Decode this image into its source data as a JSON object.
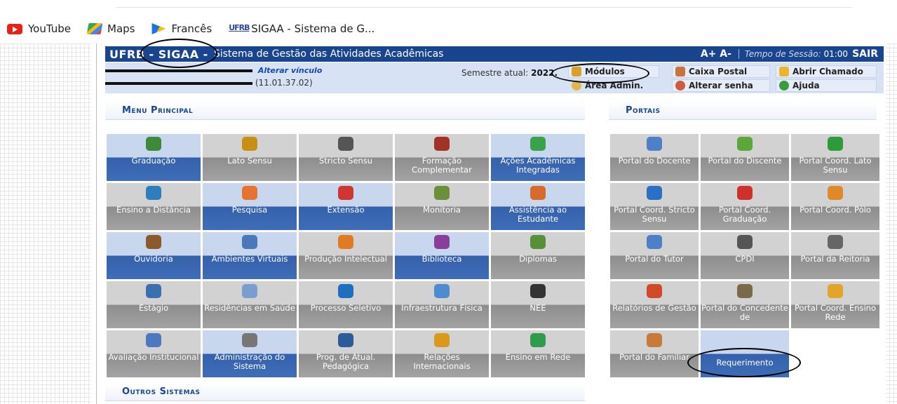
{
  "bookmarks": [
    {
      "label": "YouTube",
      "icon": "youtube-icon"
    },
    {
      "label": "Maps",
      "icon": "maps-icon"
    },
    {
      "label": "Francês",
      "icon": "translate-icon"
    },
    {
      "label": "SIGAA - Sistema de G...",
      "icon": "ufrb-icon"
    }
  ],
  "header": {
    "brand": "UFRB - SIGAA -",
    "system_name": "Sistema de Gestão das Atividades Acadêmicas",
    "font_size": "A+ A-",
    "session_label": "Tempo de Sessão:",
    "session_time": "01:00",
    "logout": "SAIR"
  },
  "user": {
    "change_link": "Alterar vínculo",
    "dept_code": "(11.01.37.02)",
    "semester_label": "Semestre atual:",
    "semester_value": "2022."
  },
  "quick_links": {
    "modulos": "Módulos",
    "caixa_postal": "Caixa Postal",
    "abrir_chamado": "Abrir Chamado",
    "area_admin": "Área Admin.",
    "alterar_senha": "Alterar senha",
    "ajuda": "Ajuda"
  },
  "menu_principal": {
    "title": "Menu Principal",
    "tiles": [
      {
        "label": "Graduação",
        "style": "blue",
        "icon": "books-icon",
        "color": "#3f8a3a"
      },
      {
        "label": "Lato Sensu",
        "style": "gray",
        "icon": "folder-icon",
        "color": "#c79014"
      },
      {
        "label": "Stricto Sensu",
        "style": "gray",
        "icon": "briefcase-icon",
        "color": "#555555"
      },
      {
        "label": "Formação Complementar",
        "style": "gray",
        "icon": "book-icon",
        "color": "#a03226"
      },
      {
        "label": "Ações Acadêmicas Integradas",
        "style": "blue",
        "icon": "puzzle-icon",
        "color": "#3aa34a"
      },
      {
        "label": "Ensino a Distância",
        "style": "gray",
        "icon": "globe-icon",
        "color": "#2c7fbf"
      },
      {
        "label": "Pesquisa",
        "style": "blue",
        "icon": "flask-icon",
        "color": "#e8732f"
      },
      {
        "label": "Extensão",
        "style": "blue",
        "icon": "gift-icon",
        "color": "#d0352f"
      },
      {
        "label": "Monitoria",
        "style": "gray",
        "icon": "presentation-icon",
        "color": "#6b8f3a"
      },
      {
        "label": "Assistência ao Estudante",
        "style": "blue",
        "icon": "user-support-icon",
        "color": "#d86a2a"
      },
      {
        "label": "Ouvidoria",
        "style": "blue",
        "icon": "user-icon",
        "color": "#8a5a2b"
      },
      {
        "label": "Ambientes Virtuais",
        "style": "blue",
        "icon": "group-icon",
        "color": "#4a78b8"
      },
      {
        "label": "Produção Intelectual",
        "style": "gray",
        "icon": "user-edit-icon",
        "color": "#e07a23"
      },
      {
        "label": "Biblioteca",
        "style": "blue",
        "icon": "book-open-icon",
        "color": "#8a3d9a"
      },
      {
        "label": "Diplomas",
        "style": "gray",
        "icon": "certificate-icon",
        "color": "#5a8f3a"
      },
      {
        "label": "Estágio",
        "style": "gray",
        "icon": "id-card-icon",
        "color": "#3b6fb0"
      },
      {
        "label": "Residências em Saúde",
        "style": "gray",
        "icon": "doctor-icon",
        "color": "#7a9ed0"
      },
      {
        "label": "Processo Seletivo",
        "style": "gray",
        "icon": "spiral-icon",
        "color": "#1f6fc0"
      },
      {
        "label": "Infraestrutura Física",
        "style": "gray",
        "icon": "network-icon",
        "color": "#4f8bd0"
      },
      {
        "label": "NEE",
        "style": "gray",
        "icon": "accessibility-icon",
        "color": "#333333"
      },
      {
        "label": "Avaliação Institucional",
        "style": "gray",
        "icon": "checklist-icon",
        "color": "#4d77c0"
      },
      {
        "label": "Administração do Sistema",
        "style": "blue",
        "icon": "gear-icon",
        "color": "#777777"
      },
      {
        "label": "Prog. de Atual. Pedagógica",
        "style": "gray",
        "icon": "monitor-icon",
        "color": "#2b5c9a"
      },
      {
        "label": "Relações Internacionais",
        "style": "gray",
        "icon": "world-icon",
        "color": "#d99a1c"
      },
      {
        "label": "Ensino em Rede",
        "style": "gray",
        "icon": "network-at-icon",
        "color": "#2e9c4a"
      }
    ]
  },
  "portais": {
    "title": "Portais",
    "tiles": [
      {
        "label": "Portal do Docente",
        "style": "gray",
        "icon": "teacher-icon",
        "color": "#4f7fc9"
      },
      {
        "label": "Portal do Discente",
        "style": "gray",
        "icon": "student-icon",
        "color": "#5aa83a"
      },
      {
        "label": "Portal Coord. Lato Sensu",
        "style": "gray",
        "icon": "user-green-icon",
        "color": "#2f9a3a"
      },
      {
        "label": "Portal Coord. Stricto Sensu",
        "style": "gray",
        "icon": "user-blue-icon",
        "color": "#2c6fc4"
      },
      {
        "label": "Portal Coord. Graduação",
        "style": "gray",
        "icon": "user-red-icon",
        "color": "#d0302a"
      },
      {
        "label": "Portal Coord. Pólo",
        "style": "gray",
        "icon": "user-orange-icon",
        "color": "#e0892a"
      },
      {
        "label": "Portal do Tutor",
        "style": "gray",
        "icon": "tutor-icon",
        "color": "#4f7fc9"
      },
      {
        "label": "CPDI",
        "style": "gray",
        "icon": "executive-icon",
        "color": "#555555"
      },
      {
        "label": "Portal da Reitoria",
        "style": "gray",
        "icon": "rector-icon",
        "color": "#666666"
      },
      {
        "label": "Relatórios de Gestão",
        "style": "gray",
        "icon": "reports-icon",
        "color": "#d04a2a"
      },
      {
        "label": "Portal do Concedente de",
        "style": "gray",
        "icon": "contract-icon",
        "color": "#7a6a4a"
      },
      {
        "label": "Portal Coord. Ensino Rede",
        "style": "gray",
        "icon": "network-at-icon",
        "color": "#e0a52a"
      },
      {
        "label": "Portal do Familiar",
        "style": "gray",
        "icon": "family-icon",
        "color": "#c87a3a"
      },
      {
        "label": "Requerimento",
        "style": "blue",
        "icon": "",
        "color": "#3560ac"
      }
    ]
  },
  "outros_sistemas": {
    "title": "Outros Sistemas"
  }
}
